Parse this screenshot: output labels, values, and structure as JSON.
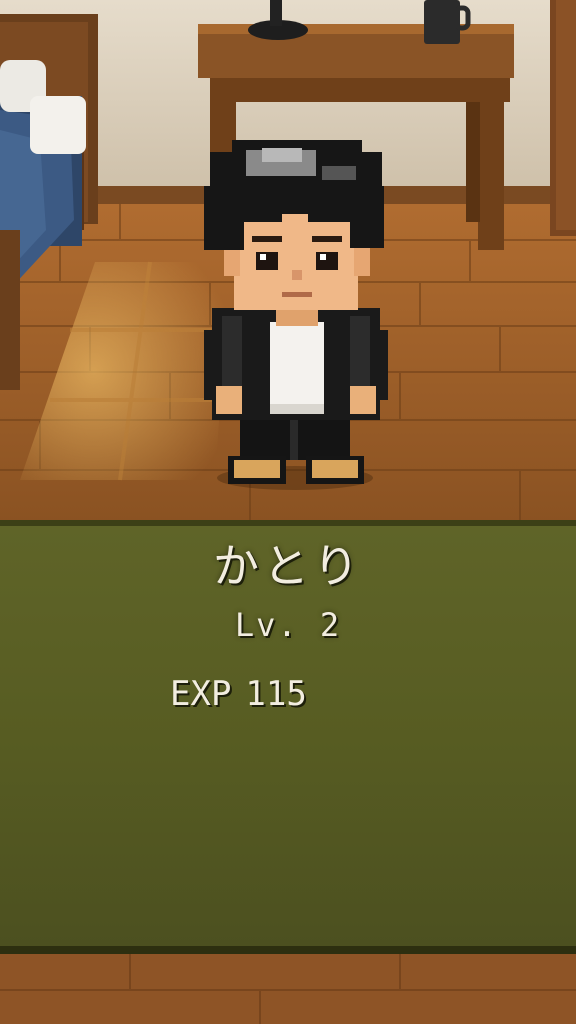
{
  "character": {
    "name": "かとり",
    "level_text": "Lv. 2",
    "exp_label": "EXP",
    "exp_value": "115"
  },
  "colors": {
    "wall": "#dcd0bc",
    "floor": "#a8642a",
    "panel": "#5a5e23",
    "text": "#f2ede0"
  }
}
